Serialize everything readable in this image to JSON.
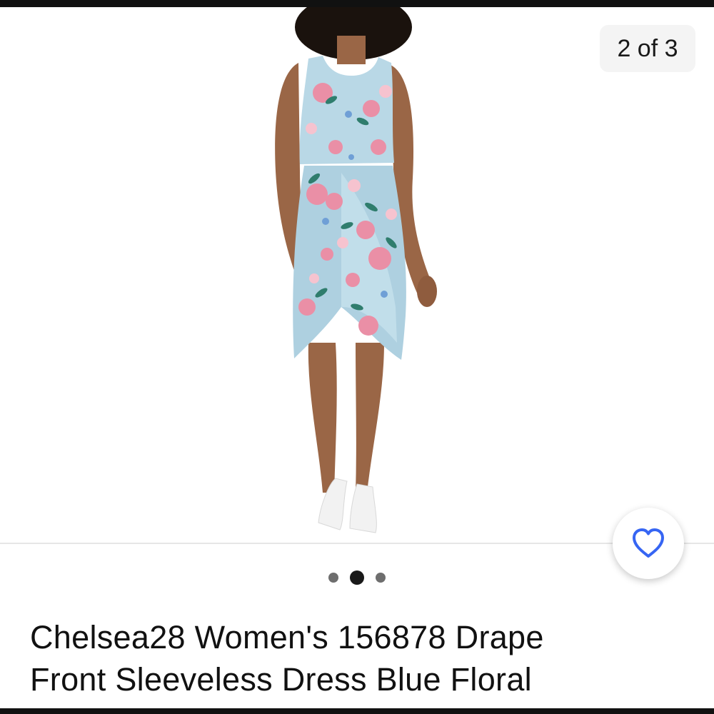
{
  "gallery": {
    "counter_text": "2 of 3",
    "image_count": 3,
    "active_index": 1
  },
  "watch_button": {
    "icon": "heart-outline-icon",
    "color": "#3665f3"
  },
  "listing": {
    "title_line1": "Chelsea28 Women's 156878 Drape",
    "title_line2": "Front Sleeveless Dress Blue Floral"
  },
  "colors": {
    "accent": "#3665f3",
    "text": "#111111",
    "dress_base": "#b9d8e6",
    "floral_pink": "#ea8fa6"
  }
}
